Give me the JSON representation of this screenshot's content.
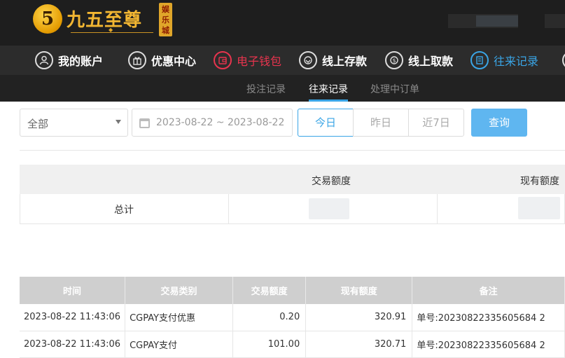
{
  "header": {
    "logo_glyph": "5",
    "logo_text": "九五至尊",
    "logo_badge": "娱乐城"
  },
  "nav": [
    {
      "label": "我的账户",
      "icon": "user-icon"
    },
    {
      "label": "优惠中心",
      "icon": "gift-icon"
    },
    {
      "label": "电子钱包",
      "icon": "wallet-icon"
    },
    {
      "label": "线上存款",
      "icon": "deposit-icon"
    },
    {
      "label": "线上取款",
      "icon": "withdraw-icon"
    },
    {
      "label": "往来记录",
      "icon": "records-icon"
    }
  ],
  "subnav": [
    "投注记录",
    "往来记录",
    "处理中订单"
  ],
  "filters": {
    "type_value": "全部",
    "date_range": "2023-08-22 ~ 2023-08-22",
    "today": "今日",
    "yesterday": "昨日",
    "last7": "近7日",
    "query": "查询"
  },
  "summary": {
    "col_amount": "交易额度",
    "col_balance": "现有额度",
    "total_label": "总计"
  },
  "table": {
    "headers": [
      "时间",
      "交易类别",
      "交易额度",
      "现有额度",
      "备注"
    ],
    "rows": [
      [
        "2023-08-22 11:43:06",
        "CGPAY支付优惠",
        "0.20",
        "320.91",
        "单号:20230822335605684 2"
      ],
      [
        "2023-08-22 11:43:06",
        "CGPAY支付",
        "101.00",
        "320.71",
        "单号:20230822335605684 2"
      ]
    ]
  },
  "colors": {
    "accent_blue": "#3aa5e6",
    "accent_red": "#e8344e",
    "logo_gold": "#f2b632"
  }
}
